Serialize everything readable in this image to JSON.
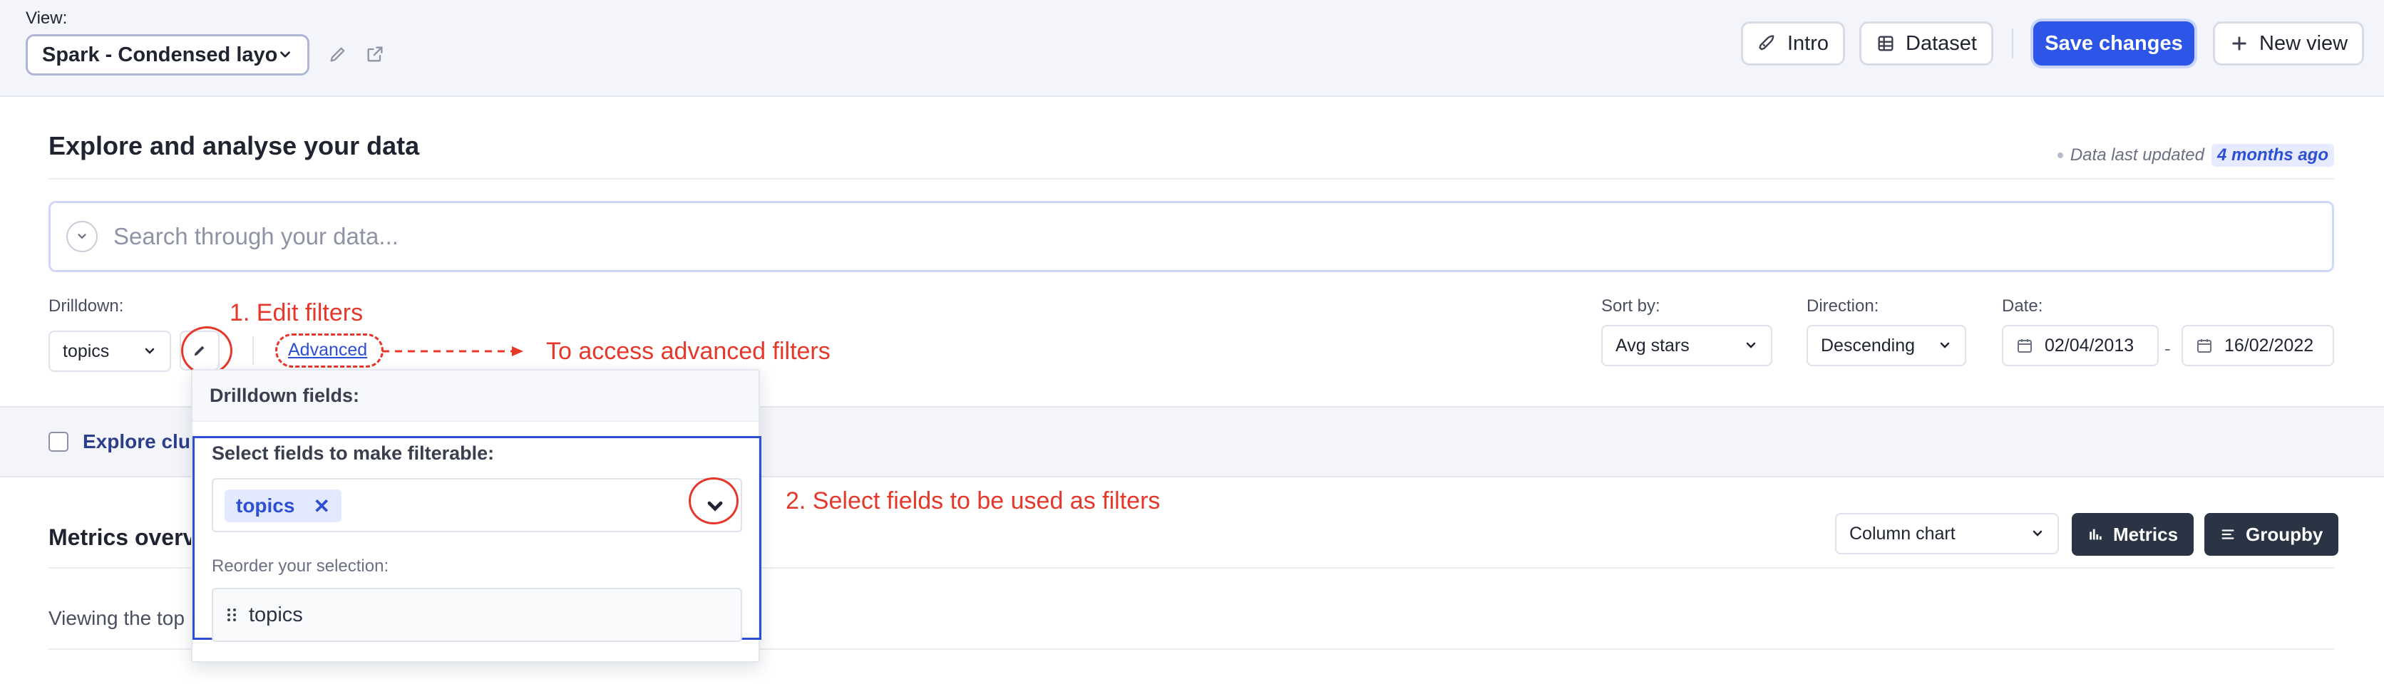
{
  "topbar": {
    "view_label": "View:",
    "view_value": "Spark - Condensed layout",
    "intro_label": "Intro",
    "dataset_label": "Dataset",
    "save_label": "Save changes",
    "new_view_label": "New view"
  },
  "explore": {
    "title": "Explore and analyse your data",
    "updated_prefix": "Data last updated",
    "updated_value": "4 months ago",
    "search_placeholder": "Search through your data..."
  },
  "controls": {
    "drilldown_label": "Drilldown:",
    "drilldown_value": "topics",
    "advanced_label": "Advanced",
    "sort_label": "Sort by:",
    "sort_value": "Avg stars",
    "direction_label": "Direction:",
    "direction_value": "Descending",
    "date_label": "Date:",
    "date_from": "02/04/2013",
    "date_sep": "-",
    "date_to": "16/02/2022"
  },
  "annotations": {
    "edit_filters": "1. Edit filters",
    "advanced_filters": "To access advanced filters",
    "select_fields": "2. Select fields to be used as filters"
  },
  "cluster": {
    "label": "Explore clusters"
  },
  "metrics": {
    "title": "Metrics overview",
    "chart_type": "Column chart",
    "metrics_label": "Metrics",
    "groupby_label": "Groupby",
    "viewing_text": "Viewing the top"
  },
  "dropdown": {
    "header": "Drilldown fields:",
    "select_label": "Select fields to make filterable:",
    "selected_tags": [
      "topics"
    ],
    "reorder_label": "Reorder your selection:",
    "reorder_items": [
      "topics"
    ]
  },
  "colors": {
    "primary": "#2d55e8",
    "annotation": "#e5382a",
    "dark_button": "#2b3444"
  }
}
